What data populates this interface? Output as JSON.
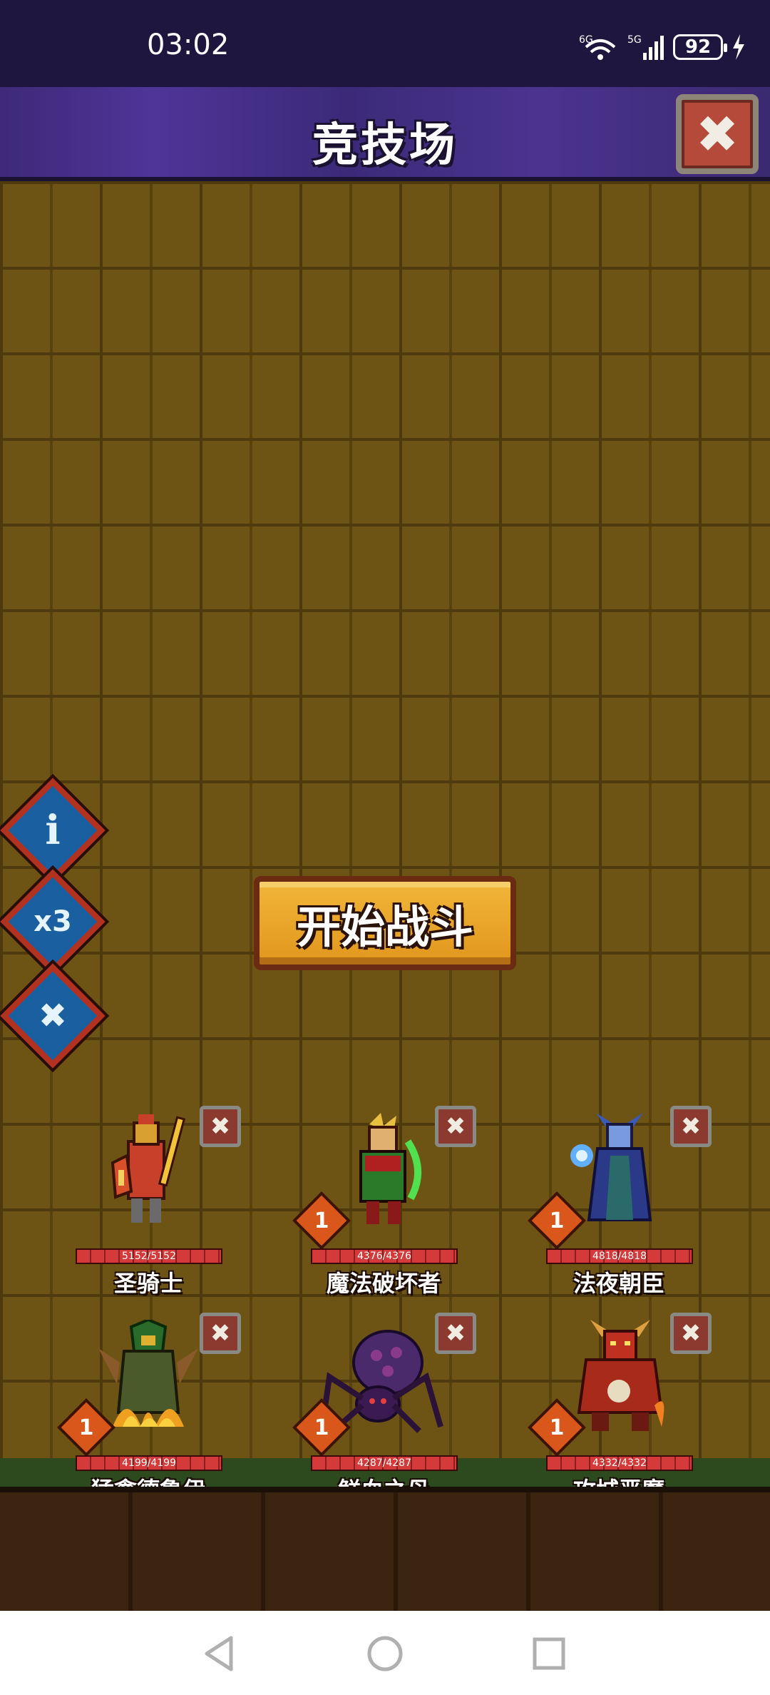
{
  "status_bar": {
    "time": "03:02",
    "network": "6G",
    "network_5g": "5G",
    "battery": "92"
  },
  "header": {
    "title": "竞技场",
    "close_icon": "close-icon"
  },
  "side_buttons": [
    {
      "name": "info",
      "label": "i"
    },
    {
      "name": "speed",
      "label": "x3"
    },
    {
      "name": "cancel",
      "label": "✖"
    }
  ],
  "start_button": {
    "label": "开始战斗"
  },
  "units": [
    {
      "name": "圣骑士",
      "hp": "5152/5152",
      "level": "",
      "color": "#d8a030"
    },
    {
      "name": "魔法破坏者",
      "hp": "4376/4376",
      "level": "1",
      "color": "#3aa23a"
    },
    {
      "name": "法夜朝臣",
      "hp": "4818/4818",
      "level": "1",
      "color": "#4a6ac8"
    },
    {
      "name": "猛禽德鲁伊",
      "hp": "4199/4199",
      "level": "1",
      "color": "#e07a1a"
    },
    {
      "name": "鲜血之母",
      "hp": "4287/4287",
      "level": "1",
      "color": "#6a3a8a"
    },
    {
      "name": "攻城恶魔",
      "hp": "4332/4332",
      "level": "1",
      "color": "#c03020"
    }
  ],
  "nav": {
    "back_icon": "back-triangle-icon",
    "home_icon": "home-circle-icon",
    "recent_icon": "recent-square-icon"
  }
}
